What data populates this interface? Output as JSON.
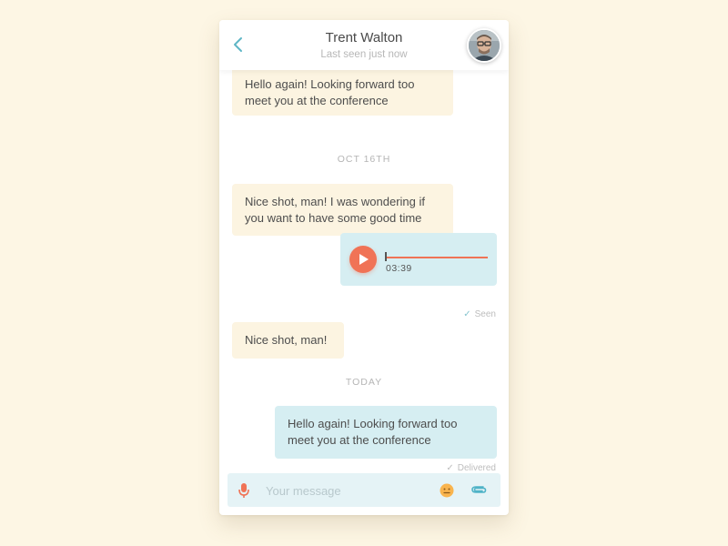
{
  "header": {
    "title": "Trent Walton",
    "subtitle": "Last seen just now",
    "back_icon": "chevron-left-icon",
    "avatar_icon": "avatar"
  },
  "messages": [
    {
      "type": "text",
      "direction": "incoming",
      "text": "Hello again! Looking forward too meet you at the conference"
    },
    {
      "type": "date",
      "text": "OCT 16TH"
    },
    {
      "type": "text",
      "direction": "incoming",
      "text": "Nice shot, man! I was wondering if you want to have some good time"
    },
    {
      "type": "voice",
      "direction": "outgoing",
      "duration": "03:39",
      "progress": 0.0
    },
    {
      "type": "status",
      "text": "Seen"
    },
    {
      "type": "text",
      "direction": "incoming",
      "text": "Nice shot, man!"
    },
    {
      "type": "date",
      "text": "TODAY"
    },
    {
      "type": "text",
      "direction": "outgoing",
      "text": "Hello again! Looking forward too meet you at the conference"
    },
    {
      "type": "status",
      "text": "Delivered"
    }
  ],
  "composer": {
    "placeholder": "Your message",
    "value": "",
    "mic_icon": "microphone-icon",
    "emoji_icon": "emoji-icon",
    "attach_icon": "paperclip-icon"
  },
  "colors": {
    "background": "#fdf6e4",
    "incoming_bubble": "#fcf4e1",
    "outgoing_bubble": "#d6eef2",
    "accent": "#f07356",
    "teal": "#5fb6c6"
  }
}
